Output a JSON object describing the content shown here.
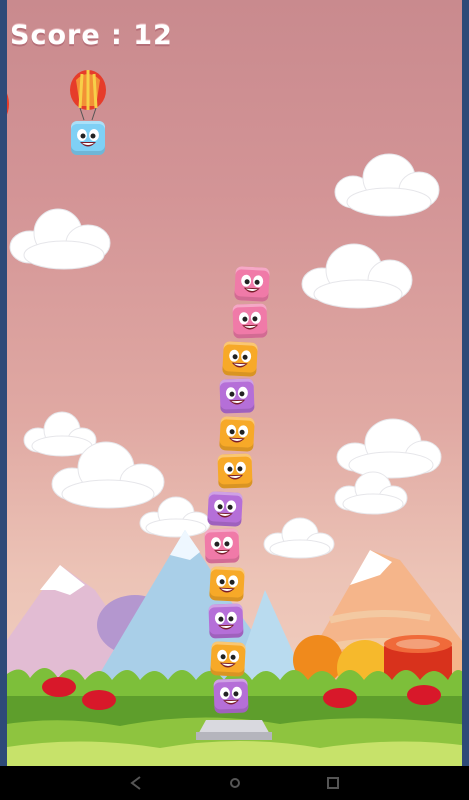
{
  "hud": {
    "score_text": "Score : 12"
  },
  "colors": {
    "pink": "#f07aa8",
    "orange": "#f7a928",
    "purple": "#b56fd8",
    "blue": "#7fd0f5"
  },
  "tower": [
    "purple",
    "orange",
    "purple",
    "orange",
    "pink",
    "purple",
    "orange",
    "orange",
    "purple",
    "orange",
    "pink",
    "pink"
  ],
  "hanging_block": "blue",
  "navbar": {
    "buttons": [
      "back-icon",
      "home-icon",
      "recent-apps-icon"
    ]
  }
}
